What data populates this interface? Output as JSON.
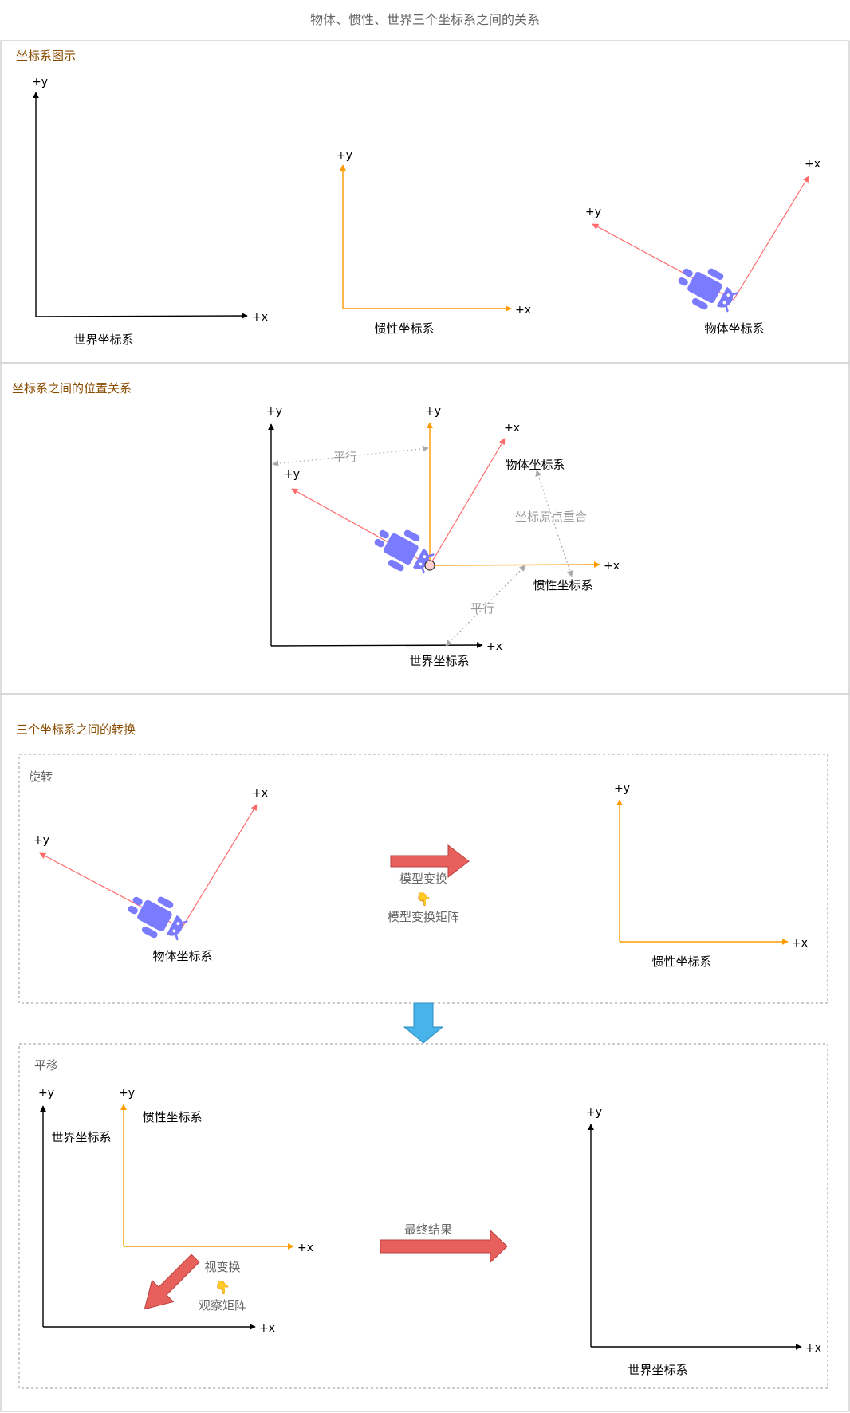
{
  "title": "物体、惯性、世界三个坐标系之间的关系",
  "sections": {
    "illustration": "坐标系图示",
    "position": "坐标系之间的位置关系",
    "transform": "三个坐标系之间的转换"
  },
  "axis": {
    "x": "+x",
    "y": "+y"
  },
  "systems": {
    "world": "世界坐标系",
    "inertial": "惯性坐标系",
    "object": "物体坐标系"
  },
  "relations": {
    "parallel": "平行",
    "origin_coincide": "坐标原点重合"
  },
  "rotation": {
    "title": "旋转",
    "step": "模型变换",
    "matrix": "模型变换矩阵"
  },
  "translation": {
    "title": "平移",
    "step": "视变换",
    "matrix": "观察矩阵",
    "result": "最终结果"
  },
  "pointer_emoji": "👇",
  "colors": {
    "world_axis": "#000000",
    "inertial_axis": "#ff9a00",
    "object_axis": "#ff6b6b",
    "robot": "#7b7bff",
    "big_arrow": "#e8605c",
    "down_arrow": "#48b3e8",
    "dotted": "#aaaaaa",
    "section_title": "#8a4c00"
  }
}
